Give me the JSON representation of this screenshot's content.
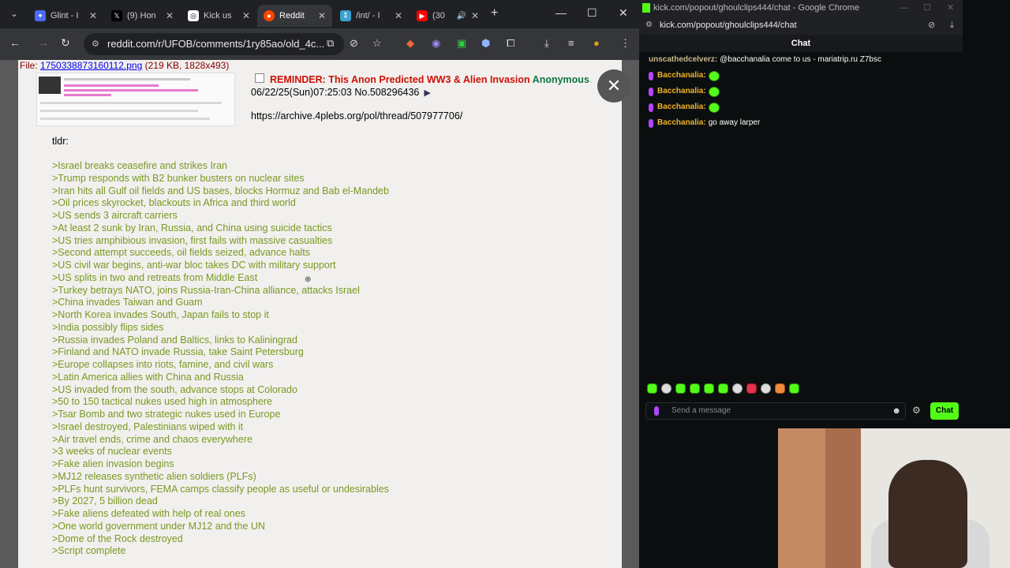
{
  "browser": {
    "tabs": [
      {
        "label": "Glint - I",
        "icon": "glint-icon",
        "color": "#4a6cf7"
      },
      {
        "label": "(9) Hon",
        "icon": "x-icon",
        "color": "#000000"
      },
      {
        "label": "Kick us",
        "icon": "openai-icon",
        "color": "#ffffff"
      },
      {
        "label": "Reddit",
        "icon": "reddit-icon",
        "color": "#ff4500"
      },
      {
        "label": "/int/ - I",
        "icon": "4chan-icon",
        "color": "#3ca0d0"
      },
      {
        "label": "(30",
        "icon": "youtube-icon",
        "color": "#ff0000"
      }
    ],
    "url": "reddit.com/r/UFOB/comments/1ry85ao/old_4c..."
  },
  "post": {
    "file_prefix": "File: ",
    "file_link": "1750338873160112.png",
    "file_info": " (219 KB, 1828x493)",
    "subject": "REMINDER: This Anon Predicted WW3 & Alien Invasion",
    "name": "Anonymous",
    "datetime": "06/22/25(Sun)07:25:03 No.508296436",
    "archive_link": "https://archive.4plebs.org/pol/thread/507977706/",
    "tldr": "tldr:",
    "lines": [
      ">Israel breaks ceasefire and strikes Iran",
      ">Trump responds with B2 bunker busters on nuclear sites",
      ">Iran hits all Gulf oil fields and US bases, blocks Hormuz and Bab el-Mandeb",
      ">Oil prices skyrocket, blackouts in Africa and third world",
      ">US sends 3 aircraft carriers",
      ">At least 2 sunk by Iran, Russia, and China using suicide tactics",
      ">US tries amphibious invasion, first fails with massive casualties",
      ">Second attempt succeeds, oil fields seized, advance halts",
      ">US civil war begins, anti-war bloc takes DC with military support",
      ">US splits in two and retreats from Middle East",
      ">Turkey betrays NATO, joins Russia-Iran-China alliance, attacks Israel",
      ">China invades Taiwan and Guam",
      ">North Korea invades South, Japan fails to stop it",
      ">India possibly flips sides",
      ">Russia invades Poland and Baltics, links to Kaliningrad",
      ">Finland and NATO invade Russia, take Saint Petersburg",
      ">Europe collapses into riots, famine, and civil wars",
      ">Latin America allies with China and Russia",
      ">US invaded from the south, advance stops at Colorado",
      ">50 to 150 tactical nukes used high in atmosphere",
      ">Tsar Bomb and two strategic nukes used in Europe",
      ">Israel destroyed, Palestinians wiped with it",
      ">Air travel ends, crime and chaos everywhere",
      ">3 weeks of nuclear events",
      ">Fake alien invasion begins",
      ">MJ12 releases synthetic alien soldiers (PLFs)",
      ">PLFs hunt survivors, FEMA camps classify people as useful or undesirables",
      ">By 2027, 5 billion dead",
      ">Fake aliens defeated with help of real ones",
      ">One world government under MJ12 and the UN",
      ">Dome of the Rock destroyed",
      ">Script complete"
    ]
  },
  "popup": {
    "window_title": "kick.com/popout/ghoulclips444/chat - Google Chrome",
    "url": "kick.com/popout/ghoulclips444/chat",
    "chat_header": "Chat",
    "messages": [
      {
        "user": "unscathedcelverz:",
        "text": " @bacchanalia come to us - mariatrip.ru Z7bsc",
        "badge": false,
        "emote": false
      },
      {
        "user": "Bacchanalia:",
        "text": "",
        "badge": true,
        "emote": true
      },
      {
        "user": "Bacchanalia:",
        "text": "",
        "badge": true,
        "emote": true
      },
      {
        "user": "Bacchanalia:",
        "text": "",
        "badge": true,
        "emote": true
      },
      {
        "user": "Bacchanalia:",
        "text": " go away larper",
        "badge": true,
        "emote": false
      }
    ],
    "input_placeholder": "Send a message",
    "send_label": "Chat",
    "accent": "#53fc18"
  }
}
